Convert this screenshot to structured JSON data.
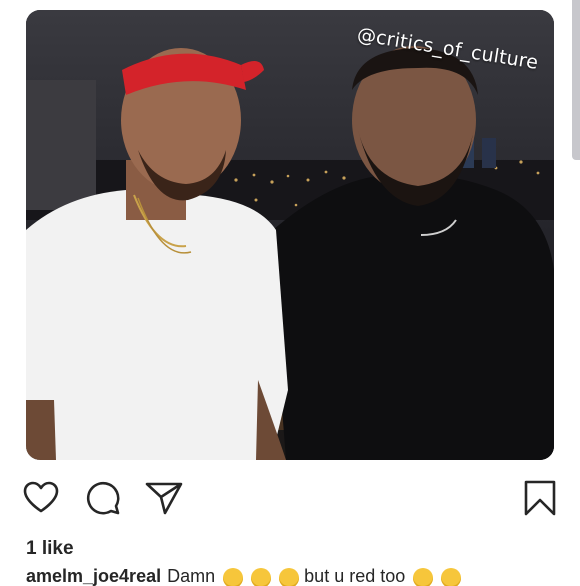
{
  "post": {
    "watermark": "@critics_of_culture",
    "photo_alt": "Two men posing at night in front of a city skyline"
  },
  "actions": {
    "like_icon": "heart-outline-icon",
    "comment_icon": "comment-bubble-icon",
    "share_icon": "paper-plane-icon",
    "save_icon": "bookmark-outline-icon"
  },
  "likes": {
    "label": "1 like"
  },
  "caption": {
    "username": "amelm_joe4real",
    "text_start": "Damn",
    "text_end": "but u red too"
  },
  "colors": {
    "text": "#262626",
    "emoji": "#f6c63b",
    "bandana": "#d4232a"
  }
}
